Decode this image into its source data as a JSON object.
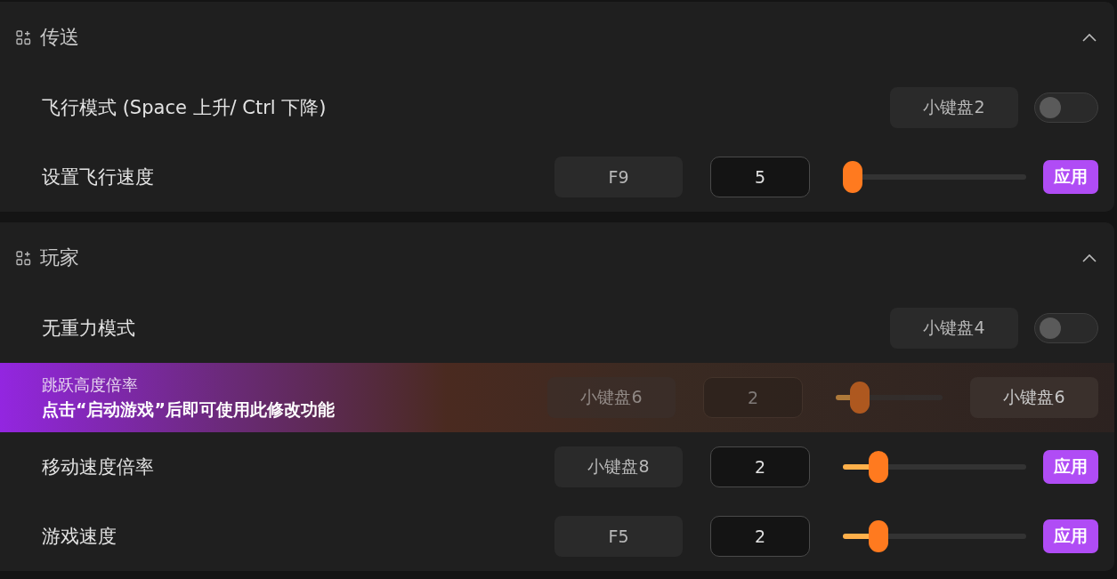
{
  "sections": [
    {
      "title": "传送",
      "expanded": true,
      "rows": [
        {
          "kind": "toggle",
          "label": "飞行模式 (Space 上升/ Ctrl 下降)",
          "key": "小键盘2",
          "on": false
        },
        {
          "kind": "slider",
          "label": "设置飞行速度",
          "key": "F9",
          "value": "5",
          "level": 0,
          "apply": "应用"
        }
      ]
    },
    {
      "title": "玩家",
      "expanded": true,
      "rows": [
        {
          "kind": "toggle",
          "label": "无重力模式",
          "key": "小键盘4",
          "on": false
        },
        {
          "kind": "slider",
          "key": "小键盘6",
          "value": "2",
          "level": 0.16,
          "overlay": {
            "title": "跳跃高度倍率",
            "hint": "点击“启动游戏”后即可使用此修改功能",
            "button": "小键盘6"
          }
        },
        {
          "kind": "slider",
          "label": "移动速度倍率",
          "key": "小键盘8",
          "value": "2",
          "level": 0.16,
          "apply": "应用"
        },
        {
          "kind": "slider",
          "label": "游戏速度",
          "key": "F5",
          "value": "2",
          "level": 0.16,
          "apply": "应用"
        }
      ]
    }
  ]
}
